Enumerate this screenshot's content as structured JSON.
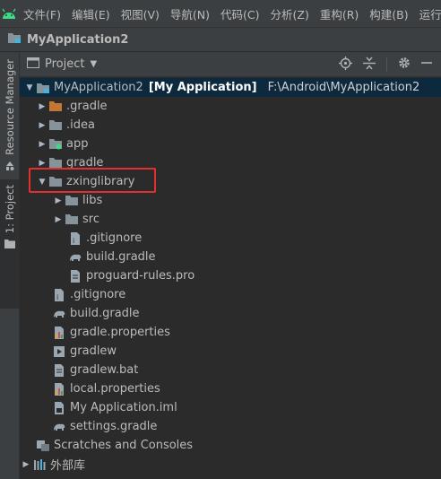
{
  "menubar": {
    "items": [
      "文件(F)",
      "编辑(E)",
      "视图(V)",
      "导航(N)",
      "代码(C)",
      "分析(Z)",
      "重构(R)",
      "构建(B)",
      "运行(U)"
    ]
  },
  "navbar": {
    "project": "MyApplication2"
  },
  "toolstrip": {
    "resource_manager": "Resource Manager",
    "project_tab": "1: Project"
  },
  "panel": {
    "title": "Project",
    "icons": [
      "locate-icon",
      "collapse-all-icon",
      "gear-icon",
      "minimize-icon"
    ]
  },
  "tree": {
    "root": {
      "name": "MyApplication2",
      "module": "[My Application]",
      "path": "F:\\Android\\MyApplication2"
    },
    "rows": [
      {
        "label": ".gradle"
      },
      {
        "label": ".idea"
      },
      {
        "label": "app"
      },
      {
        "label": "gradle"
      },
      {
        "label": "zxinglibrary"
      },
      {
        "label": "libs"
      },
      {
        "label": "src"
      },
      {
        "label": ".gitignore"
      },
      {
        "label": "build.gradle"
      },
      {
        "label": "proguard-rules.pro"
      },
      {
        "label": ".gitignore"
      },
      {
        "label": "build.gradle"
      },
      {
        "label": "gradle.properties"
      },
      {
        "label": "gradlew"
      },
      {
        "label": "gradlew.bat"
      },
      {
        "label": "local.properties"
      },
      {
        "label": "My Application.iml"
      },
      {
        "label": "settings.gradle"
      },
      {
        "label": "Scratches and Consoles"
      },
      {
        "label": "外部库"
      }
    ]
  },
  "colors": {
    "highlight": "#e0312f",
    "root_bg": "#0d293e",
    "folder": "#87939a",
    "gradle_folder": "#c57633"
  }
}
